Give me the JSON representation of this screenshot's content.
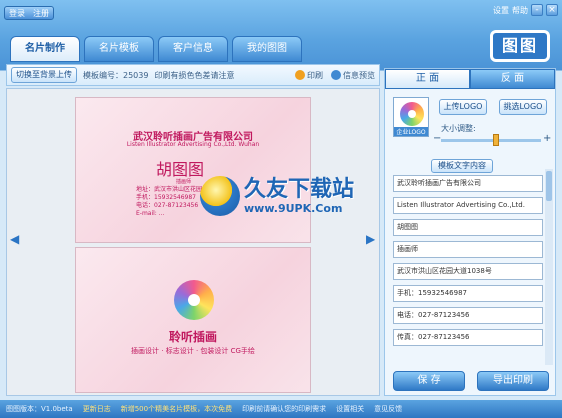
{
  "titlebar": {
    "login_label": "登录",
    "register_label": "注册",
    "settings_label": "设置",
    "help_label": "帮助",
    "minimize_glyph": "-",
    "close_glyph": "×"
  },
  "tabs": [
    {
      "label": "名片制作",
      "active": true
    },
    {
      "label": "名片模板",
      "active": false
    },
    {
      "label": "客户信息",
      "active": false
    },
    {
      "label": "我的图图",
      "active": false
    }
  ],
  "logo_text": "图图",
  "toolbar": {
    "switch_button": "切换至背景上传",
    "template_number": "模板编号：25039",
    "tip": "印刷有损色色差请注意",
    "print_label": "印刷",
    "preview_label": "信息预览"
  },
  "front_card": {
    "company": "武汉聆听插画广告有限公司",
    "company_en": "Listen Illustrator Advertising Co.,Ltd. Wuhan",
    "name": "胡图图",
    "role": "插画师",
    "lines": [
      "地址：武汉市洪山区花园大道1038号",
      "手机：15932546987",
      "电话：027-87123456",
      "E-mail: ..."
    ]
  },
  "back_card": {
    "title": "聆听插画",
    "subtitle": "插画设计 · 标志设计 · 包装设计 CG手绘"
  },
  "watermark": {
    "text": "久友下载站",
    "url": "www.9UPK.Com"
  },
  "panel": {
    "tab_front": "正 面",
    "tab_back": "反 面",
    "logo_caption": "企业LOGO",
    "upload_logo": "上传LOGO",
    "pick_logo": "挑选LOGO",
    "size_label": "大小调整:",
    "size_value": 0.55,
    "fields_button": "模板文字内容",
    "fields": [
      "武汉聆听插画广告有限公司",
      "Listen Illustrator Advertising Co.,Ltd.",
      "胡图图",
      "插画师",
      "武汉市洪山区花园大道1038号",
      "手机：15932546987",
      "电话：027-87123456",
      "传真：027-87123456"
    ],
    "save_button": "保 存",
    "export_button": "导出印刷"
  },
  "statusbar": {
    "version": "图图版本：V1.0beta",
    "update": "更新日志",
    "notice1": "新增500个精美名片模板，本次免费",
    "notice2": "印刷前请确认您的印刷需求",
    "settings": "设置相关",
    "feedback": "意见反馈"
  },
  "colors": {
    "brand_blue": "#3f89d2",
    "card_pink": "#f6d3de",
    "card_text": "#c0185e"
  }
}
